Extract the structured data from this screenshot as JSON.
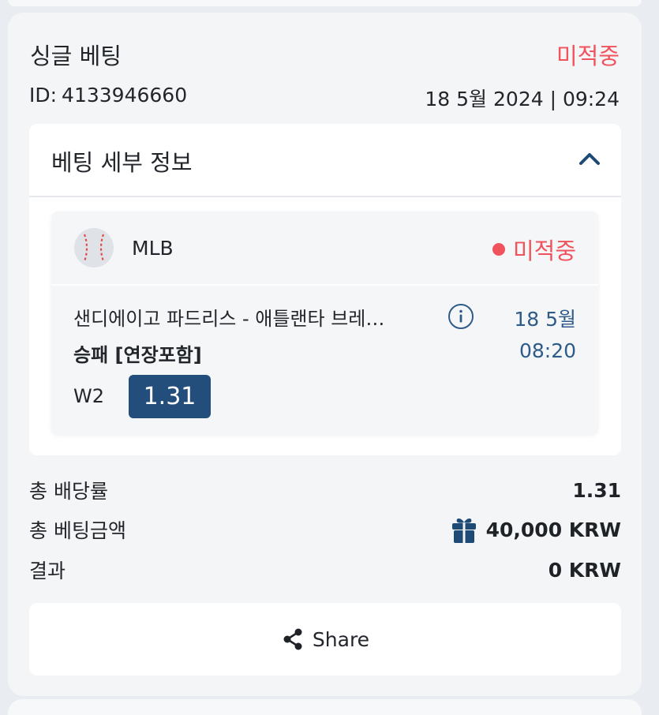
{
  "bet": {
    "type_title": "싱글 베팅",
    "status": "미적중",
    "id_label": "ID:",
    "id_value": "4133946660",
    "datetime": "18 5월 2024 | 09:24"
  },
  "details": {
    "title": "베팅 세부 정보",
    "event": {
      "league_icon": "baseball-icon",
      "league": "MLB",
      "status": "미적중",
      "match": "샌디에이고 파드리스 - 애틀랜타 브레…",
      "date": "18 5월",
      "time": "08:20",
      "market": "승패 [연장포함]",
      "selection": "W2",
      "odds": "1.31"
    }
  },
  "summary": {
    "total_odds_label": "총 배당률",
    "total_odds_value": "1.31",
    "total_stake_label": "총 베팅금액",
    "total_stake_value": "40,000 KRW",
    "result_label": "결과",
    "result_value": "0 KRW"
  },
  "share": {
    "label": "Share",
    "icon": "share-icon"
  },
  "colors": {
    "lost": "#f0535c",
    "accent": "#234e7c",
    "date_text": "#2e5b88"
  }
}
